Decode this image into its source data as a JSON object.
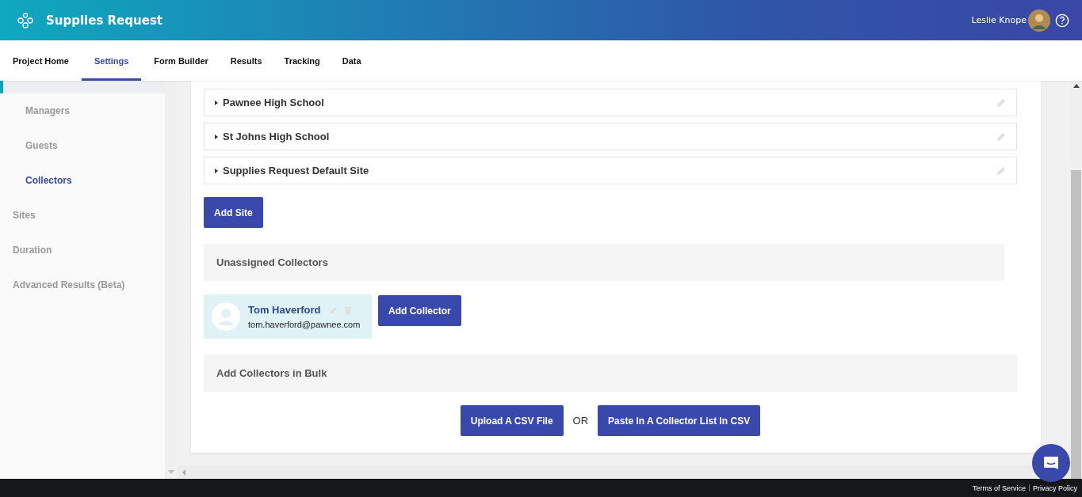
{
  "app": {
    "title": "Supplies Request",
    "user": "Leslie Knope"
  },
  "tabs": [
    {
      "label": "Project Home",
      "selected": false
    },
    {
      "label": "Settings",
      "selected": true
    },
    {
      "label": "Form Builder",
      "selected": false
    },
    {
      "label": "Results",
      "selected": false
    },
    {
      "label": "Tracking",
      "selected": false
    },
    {
      "label": "Data",
      "selected": false
    }
  ],
  "sidebar": {
    "items": [
      {
        "label": "Managers",
        "sub": true,
        "selected": false
      },
      {
        "label": "Guests",
        "sub": true,
        "selected": false
      },
      {
        "label": "Collectors",
        "sub": true,
        "selected": true
      },
      {
        "label": "Sites",
        "sub": false,
        "selected": false
      },
      {
        "label": "Duration",
        "sub": false,
        "selected": false
      },
      {
        "label": "Advanced Results (Beta)",
        "sub": false,
        "selected": false
      }
    ]
  },
  "sites": [
    {
      "name": "Pawnee High School",
      "expanded": false
    },
    {
      "name": "St Johns High School",
      "expanded": false
    },
    {
      "name": "Supplies Request Default Site",
      "expanded": false
    }
  ],
  "add_site": "Add Site",
  "unassigned": {
    "title": "Unassigned Collectors",
    "collectors": [
      {
        "name": "Tom Haverford",
        "email": "tom.haverford@pawnee.com"
      }
    ],
    "add": "Add Collector"
  },
  "bulk": {
    "title": "Add Collectors in Bulk",
    "upload": "Upload A CSV File",
    "or": "OR",
    "paste": "Paste In A Collector List In CSV"
  },
  "footer": {
    "links": [
      "Terms of Service",
      "Privacy Policy"
    ]
  }
}
